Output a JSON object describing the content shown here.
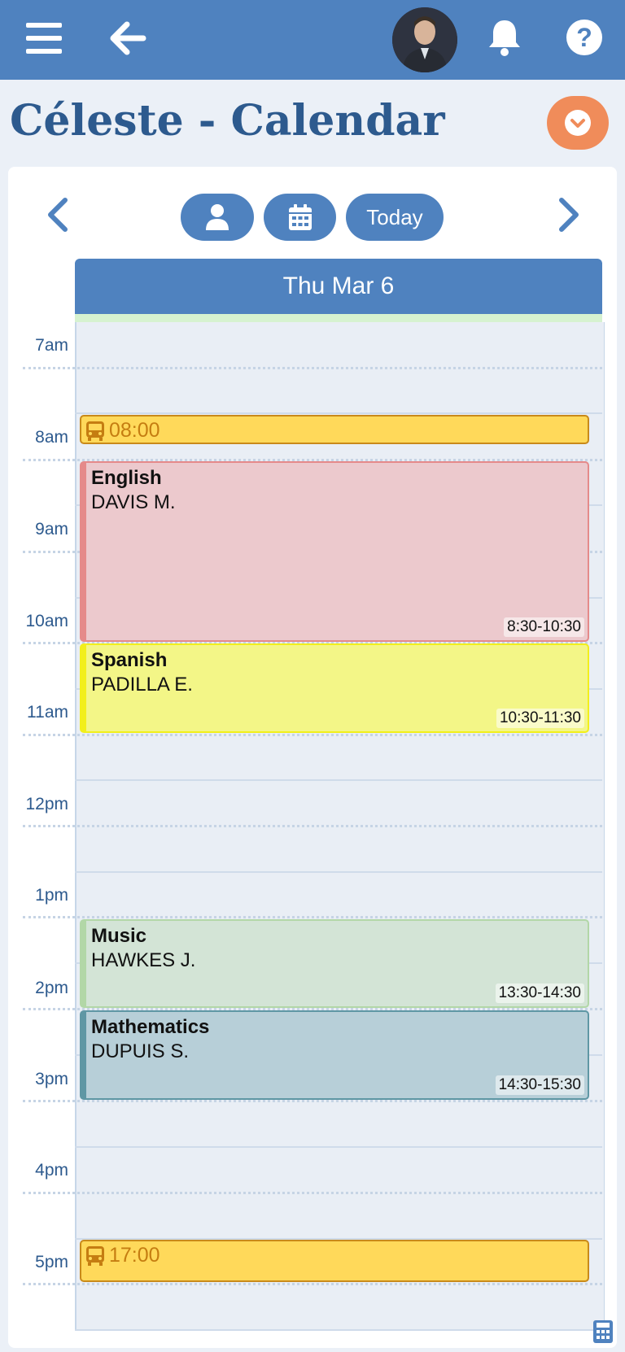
{
  "header": {
    "title": "Céleste - Calendar"
  },
  "toolbar": {
    "today_label": "Today"
  },
  "day_header": "Thu Mar 6",
  "hours": [
    "7am",
    "8am",
    "9am",
    "10am",
    "11am",
    "12pm",
    "1pm",
    "2pm",
    "3pm",
    "4pm",
    "5pm"
  ],
  "transport": [
    {
      "time": "08:00"
    },
    {
      "time": "17:00"
    }
  ],
  "events": [
    {
      "subject": "English",
      "teacher": "DAVIS M.",
      "range": "8:30-10:30",
      "color": "#ecc9cd",
      "border": "#e58a8a"
    },
    {
      "subject": "Spanish",
      "teacher": "PADILLA E.",
      "range": "10:30-11:30",
      "color": "#f3f687",
      "border": "#f2ef1b"
    },
    {
      "subject": "Music",
      "teacher": "HAWKES J.",
      "range": "13:30-14:30",
      "color": "#d3e4d6",
      "border": "#b2d7a7"
    },
    {
      "subject": "Mathematics",
      "teacher": "DUPUIS S.",
      "range": "14:30-15:30",
      "color": "#b7cfd8",
      "border": "#5f97a4"
    }
  ],
  "colors": {
    "primary": "#4f82bf",
    "accent": "#f08c5a",
    "title": "#2d5a8e",
    "bus_fill": "#ffd95a"
  },
  "icons": [
    "hamburger-menu-icon",
    "back-arrow-icon",
    "bell-icon",
    "help-icon",
    "chevron-down-icon",
    "person-icon",
    "calendar-icon",
    "bus-icon",
    "calculator-icon"
  ]
}
